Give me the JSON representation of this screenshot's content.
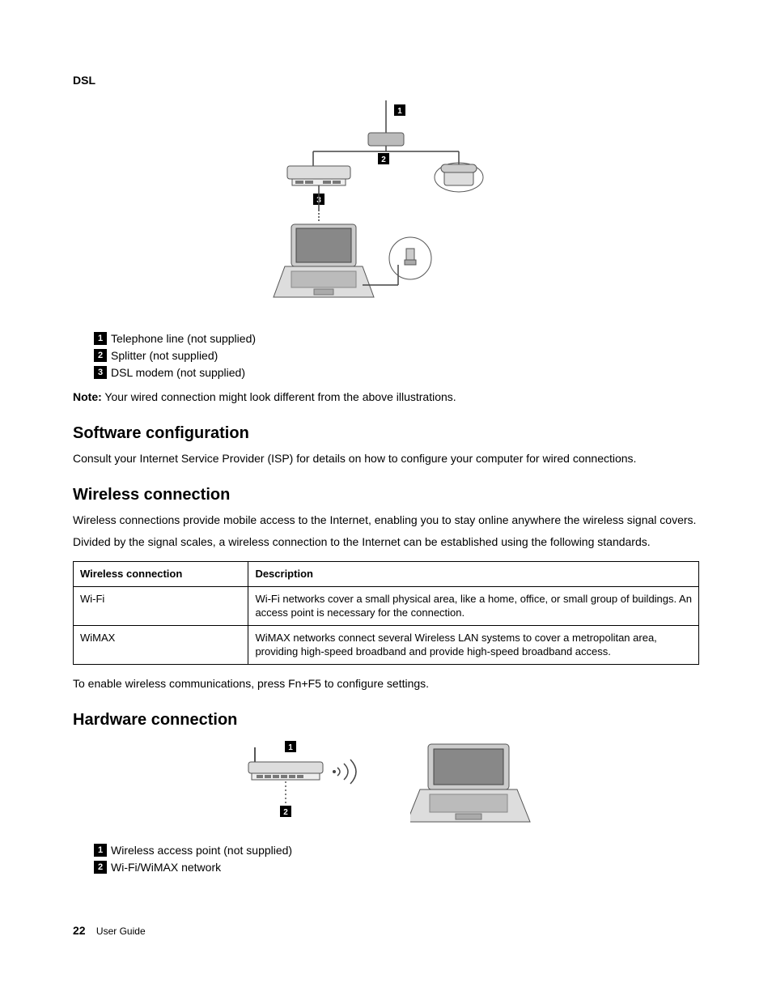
{
  "dsl": {
    "heading": "DSL",
    "callouts": [
      {
        "num": "1",
        "text": "Telephone line (not supplied)"
      },
      {
        "num": "2",
        "text": "Splitter (not supplied)"
      },
      {
        "num": "3",
        "text": "DSL modem (not supplied)"
      }
    ],
    "diagram_labels": {
      "c1": "1",
      "c2": "2",
      "c3": "3"
    }
  },
  "note": {
    "label": "Note:",
    "text": "Your wired connection might look different from the above illustrations."
  },
  "software": {
    "heading": "Software configuration",
    "para": "Consult your Internet Service Provider (ISP) for details on how to configure your computer for wired connections."
  },
  "wireless": {
    "heading": "Wireless connection",
    "para1": "Wireless connections provide mobile access to the Internet, enabling you to stay online anywhere the wireless signal covers.",
    "para2": "Divided by the signal scales, a wireless connection to the Internet can be established using the following standards.",
    "table": {
      "head_col1": "Wireless connection",
      "head_col2": "Description",
      "rows": [
        {
          "c1": "Wi-Fi",
          "c2": "Wi-Fi networks cover a small physical area, like a home, office, or small group of buildings. An access point is necessary for the connection."
        },
        {
          "c1": "WiMAX",
          "c2": "WiMAX networks connect several Wireless LAN systems to cover a metropolitan area, providing high-speed broadband and provide high-speed broadband access."
        }
      ]
    },
    "enable_text": "To enable wireless communications, press Fn+F5 to configure settings."
  },
  "hardware": {
    "heading": "Hardware connection",
    "diagram_labels": {
      "c1": "1",
      "c2": "2"
    },
    "callouts": [
      {
        "num": "1",
        "text": "Wireless access point (not supplied)"
      },
      {
        "num": "2",
        "text": "Wi-Fi/WiMAX network"
      }
    ]
  },
  "footer": {
    "page": "22",
    "title": "User Guide"
  }
}
